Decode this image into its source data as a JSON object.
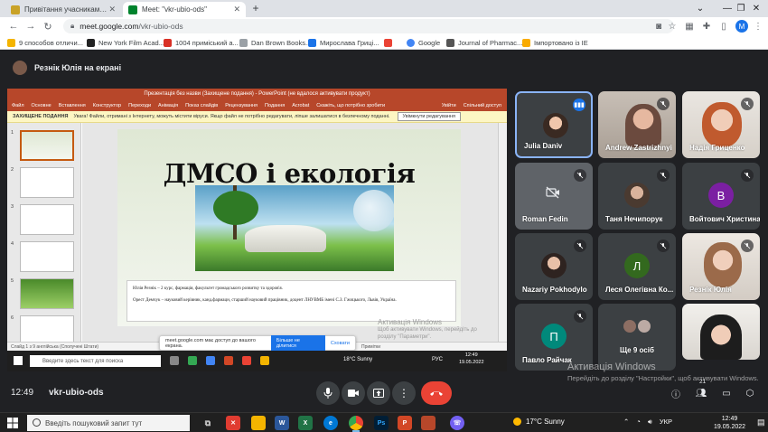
{
  "browser": {
    "tabs": [
      {
        "title": "Привітання учасникам студентської",
        "favicon_color": "#c9a227"
      },
      {
        "title": "Meet: \"vkr-ubio-ods\"",
        "favicon_color": "#00832d"
      }
    ],
    "new_tab_label": "+",
    "url_host": "meet.google.com",
    "url_path": "/vkr-ubio-ods",
    "profile_initial": "M",
    "bookmarks": [
      {
        "label": "9 способов отличи...",
        "color": "#f4b400"
      },
      {
        "label": "New York Film Acad...",
        "color": "#222222"
      },
      {
        "label": "1004 приміський а...",
        "color": "#d93025"
      },
      {
        "label": "Dan Brown Books...",
        "color": "#9aa0a6"
      },
      {
        "label": "Мирослава Гриці...",
        "color": "#1a73e8"
      },
      {
        "label": "",
        "color": "#ea4335"
      },
      {
        "label": "Google",
        "color": "#4285f4"
      },
      {
        "label": "Journal of Pharmac...",
        "color": "#555555"
      },
      {
        "label": "Імпортовано із IE",
        "color": "#f9ab00"
      }
    ]
  },
  "meet": {
    "presenter_label": "Резнік Юлія на екрані",
    "time": "12:49",
    "code": "vkr-ubio-ods",
    "people_count": "21",
    "participants": [
      {
        "name": "Julia Daniv",
        "type": "photo",
        "speaking": true
      },
      {
        "name": "Andrew Zastrizhnyi",
        "type": "video",
        "muted": true
      },
      {
        "name": "Надія Гриценко",
        "type": "video",
        "muted": true
      },
      {
        "name": "Roman Fedin",
        "type": "camera-off",
        "muted": true
      },
      {
        "name": "Таня Нечипорук",
        "type": "photo",
        "muted": true
      },
      {
        "name": "Войтович Христина",
        "type": "letter",
        "letter": "В",
        "color": "#7b1fa2",
        "muted": true
      },
      {
        "name": "Nazariy Pokhodylo",
        "type": "photo",
        "muted": true
      },
      {
        "name": "Леся Олегівна Ко...",
        "type": "letter",
        "letter": "Л",
        "color": "#33691e",
        "muted": true
      },
      {
        "name": "Резнік Юлія",
        "type": "video",
        "muted": true
      },
      {
        "name": "Павло Райчак",
        "type": "letter",
        "letter": "П",
        "color": "#00897b",
        "muted": true
      },
      {
        "name": "Ще 9 осіб",
        "type": "more"
      },
      {
        "name": "",
        "type": "video"
      }
    ]
  },
  "shared_screen": {
    "ppt_title": "Презентація без назви (Захищене подання) - PowerPoint (не вдалося активувати продукт)",
    "ribbon_tabs": [
      "Файл",
      "Основне",
      "Вставлення",
      "Конструктор",
      "Переходи",
      "Анімація",
      "Показ слайдів",
      "Рецензування",
      "Подання",
      "Acrobat",
      "Скажіть, що потрібно зробити"
    ],
    "ribbon_right": [
      "Увійти",
      "Спільний доступ"
    ],
    "warning_label": "ЗАХИЩЕНЕ ПОДАННЯ",
    "warning_text": "Увага! Файли, отримані з Інтернету, можуть містити віруси. Якщо файл не потрібно редагувати, ліпше залишатися в безпечному поданні.",
    "warning_button": "Увімкнути редагування",
    "slide_title": "ДМСО і екологія",
    "slide_line1": "Юлія Резнік – 2 курс, фармація, факультет громадського розвитку та здоров'я.",
    "slide_line2": "Орест Демчук – науковий керівник, канд.фармацн, старший науковий працівник, доцент ЛНУВМБ імені С.З. Гжицького, Львів, Україна.",
    "status_text": "Слайд 1 з 9    англійська (Сполучені Штати)",
    "notes_label": "Примітки",
    "share_banner_text": "meet.google.com має доступ до вашого екрана.",
    "share_stop": "Більше не ділитися",
    "share_hide": "Сховати",
    "inner_activation_title": "Активація Windows",
    "inner_activation_text": "Щоб активувати Windows, перейдіть до розділу \"Параметри\".",
    "inner_search": "Введите здесь текст для поиска",
    "inner_weather": "18°C  Sunny",
    "inner_lang": "РУС",
    "inner_time": "12:49",
    "inner_date": "19.05.2022"
  },
  "activation": {
    "title": "Активація Windows",
    "text": "Перейдіть до розділу \"Настройки\", щоб активувати Windows."
  },
  "taskbar": {
    "search_placeholder": "Введіть пошуковий запит тут",
    "weather": "17°C  Sunny",
    "lang": "УКР",
    "time": "12:49",
    "date": "19.05.2022"
  }
}
